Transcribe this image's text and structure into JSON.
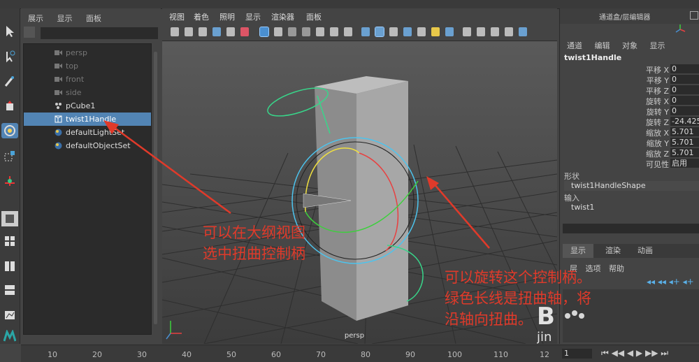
{
  "outliner": {
    "menu": [
      "展示",
      "显示",
      "面板"
    ],
    "items": [
      {
        "label": "persp",
        "icon": "camera-icon"
      },
      {
        "label": "top",
        "icon": "camera-icon"
      },
      {
        "label": "front",
        "icon": "camera-icon"
      },
      {
        "label": "side",
        "icon": "camera-icon"
      },
      {
        "label": "pCube1",
        "icon": "mesh-icon"
      },
      {
        "label": "twist1Handle",
        "icon": "deformer-handle-icon"
      },
      {
        "label": "defaultLightSet",
        "icon": "set-icon"
      },
      {
        "label": "defaultObjectSet",
        "icon": "set-icon"
      }
    ],
    "selected": "twist1Handle"
  },
  "viewport": {
    "menu": [
      "视图",
      "着色",
      "照明",
      "显示",
      "渲染器",
      "面板"
    ],
    "camera_label": "persp"
  },
  "channel_box": {
    "title": "通道盒/层编辑器",
    "menu": [
      "通道",
      "编辑",
      "对象",
      "显示"
    ],
    "node": "twist1Handle",
    "attributes": [
      {
        "label": "平移 X",
        "value": "0"
      },
      {
        "label": "平移 Y",
        "value": "0"
      },
      {
        "label": "平移 Z",
        "value": "0"
      },
      {
        "label": "旋转 X",
        "value": "0"
      },
      {
        "label": "旋转 Y",
        "value": "0"
      },
      {
        "label": "旋转 Z",
        "value": "-24.425"
      },
      {
        "label": "缩放 X",
        "value": "5.701"
      },
      {
        "label": "缩放 Y",
        "value": "5.701"
      },
      {
        "label": "缩放 Z",
        "value": "5.701"
      },
      {
        "label": "可见性",
        "value": "启用"
      }
    ],
    "shapes_label": "形状",
    "shape_name": "twist1HandleShape",
    "inputs_label": "输入",
    "input_name": "twist1",
    "layer_tabs": [
      "显示",
      "渲染",
      "动画"
    ],
    "layer_menu": [
      "层",
      "选项",
      "帮助"
    ]
  },
  "timeline": {
    "ticks": [
      "10",
      "20",
      "30",
      "40",
      "50",
      "60",
      "70",
      "80",
      "90",
      "100",
      "110",
      "12"
    ],
    "current_frame": "1"
  },
  "annotations": {
    "outliner_note_line1": "可以在大纲视图",
    "outliner_note_line2": "选中扭曲控制柄",
    "handle_note_line1": "可以旋转这个控制柄。",
    "handle_note_line2": "绿色长线是扭曲轴，将",
    "handle_note_line3": "沿轴向扭曲。",
    "watermark": "Baidu jingyan",
    "annotation_color": "#e03a2a"
  },
  "colors": {
    "selection": "#5284b4",
    "panel": "#444444",
    "field": "#2b2b2b"
  }
}
